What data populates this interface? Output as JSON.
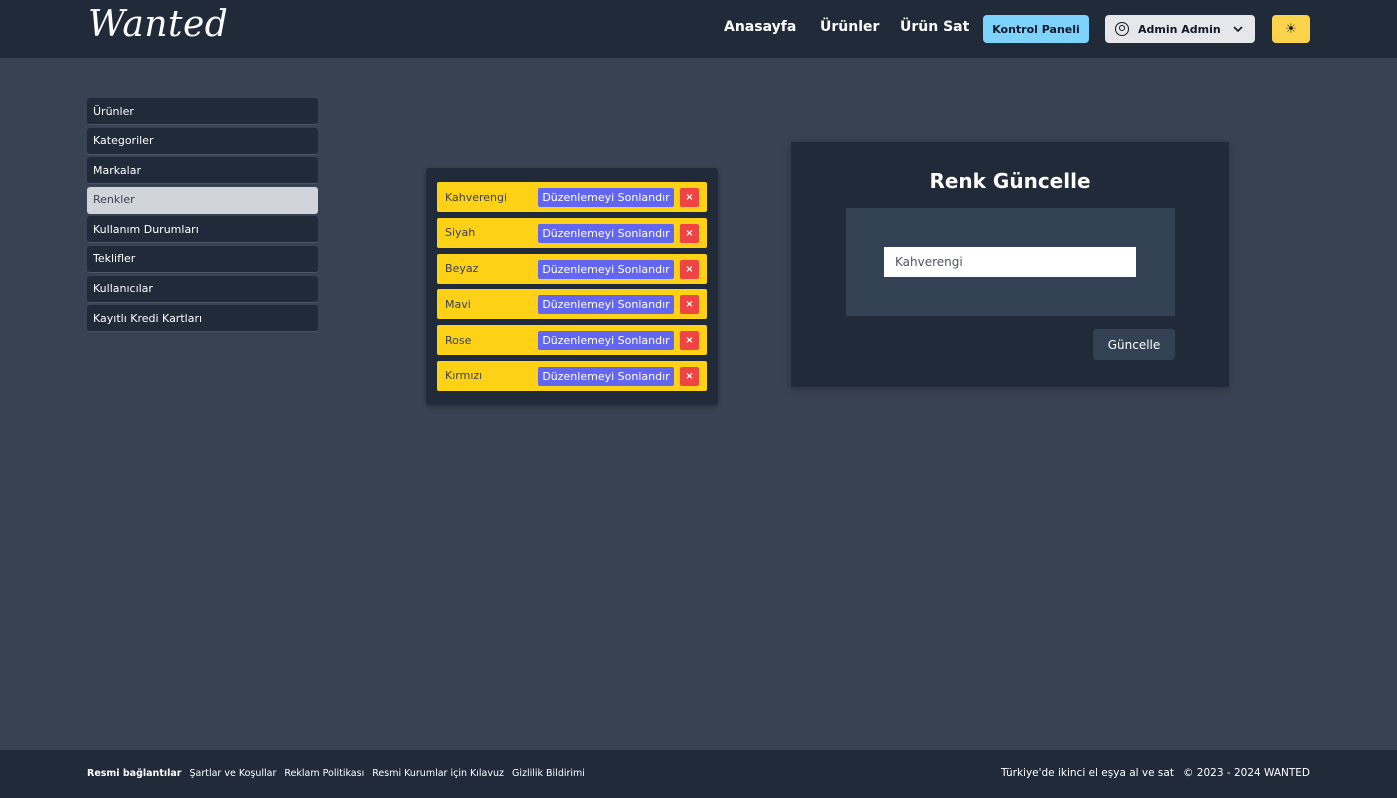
{
  "header": {
    "logo": "Wanted",
    "nav": [
      "Anasayfa",
      "Ürünler",
      "Ürün Sat"
    ],
    "panel_button": "Kontrol Paneli",
    "user_button": "Admin Admin",
    "theme_icon": "sun-icon"
  },
  "sidebar": {
    "items": [
      {
        "label": "Ürünler"
      },
      {
        "label": "Kategoriler"
      },
      {
        "label": "Markalar"
      },
      {
        "label": "Renkler",
        "active": true
      },
      {
        "label": "Kullanım Durumları"
      },
      {
        "label": "Teklifler"
      },
      {
        "label": "Kullanıcılar"
      },
      {
        "label": "Kayıtlı Kredi Kartları"
      }
    ]
  },
  "colors": {
    "edit_label": "Düzenlemeyi Sonlandır",
    "delete_label": "×",
    "items": [
      "Kahverengi",
      "Siyah",
      "Beyaz",
      "Mavi",
      "Rose",
      "Kırmızı"
    ]
  },
  "update_panel": {
    "title": "Renk Güncelle",
    "input_value": "Kahverengi",
    "button": "Güncelle"
  },
  "footer": {
    "links_title": "Resmi bağlantılar",
    "links": [
      "Şartlar ve Koşullar",
      "Reklam Politikası",
      "Resmi Kurumlar için Kılavuz",
      "Gizlilik Bildirimi"
    ],
    "tagline": "Türkiye'de ikinci el eşya al ve sat",
    "copyright": "© 2023 - 2024 WANTED"
  },
  "theme": {
    "background": "#394253",
    "surface": "#212a39",
    "accent_yellow": "#fcd116",
    "accent_indigo": "#6366f1",
    "accent_red": "#ef4444",
    "accent_sky": "#7dd3fc"
  }
}
